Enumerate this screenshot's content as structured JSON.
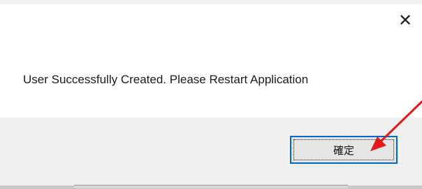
{
  "dialog": {
    "close_glyph": "✕",
    "message": "User Successfully Created. Please Restart Application",
    "ok_label": "確定"
  },
  "annotation": {
    "arrow_color": "#e11b1b"
  }
}
